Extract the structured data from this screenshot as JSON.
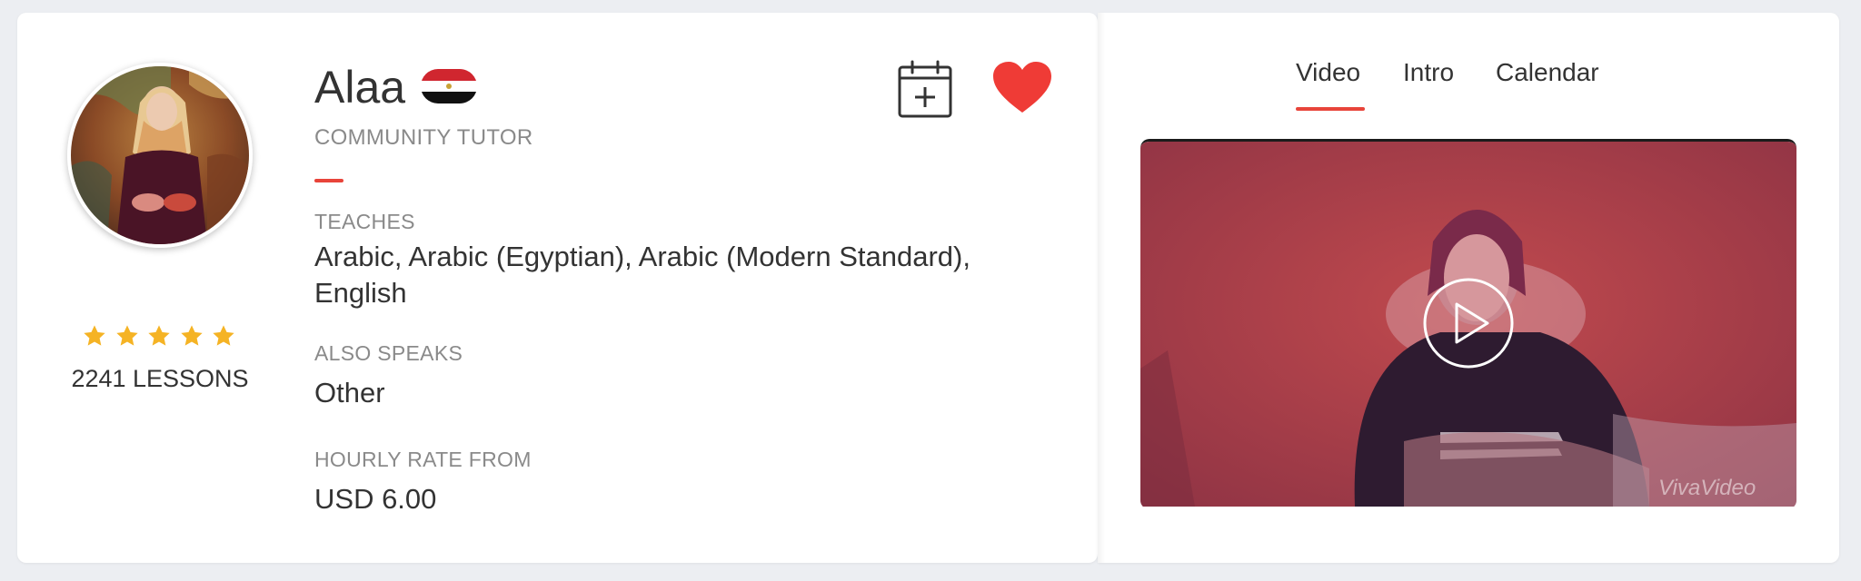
{
  "tutor": {
    "name": "Alaa",
    "country_flag": "egypt-flag",
    "type": "COMMUNITY TUTOR",
    "rating_stars": 5,
    "lessons": "2241 LESSONS"
  },
  "details": {
    "teaches_label": "TEACHES",
    "teaches_value": "Arabic, Arabic (Egyptian), Arabic (Modern Standard), English",
    "speaks_label": "ALSO SPEAKS",
    "speaks_value": "Other",
    "rate_label": "HOURLY RATE FROM",
    "rate_value": "USD 6.00"
  },
  "actions": {
    "calendar_icon": "calendar-add-icon",
    "favorite_icon": "heart-icon"
  },
  "tabs": [
    {
      "label": "Video",
      "active": true
    },
    {
      "label": "Intro",
      "active": false
    },
    {
      "label": "Calendar",
      "active": false
    }
  ],
  "video": {
    "watermark": "VivaVideo",
    "play_icon": "play-icon"
  },
  "colors": {
    "accent": "#e8443a",
    "star": "#f5b324",
    "heart": "#ef3b36"
  }
}
